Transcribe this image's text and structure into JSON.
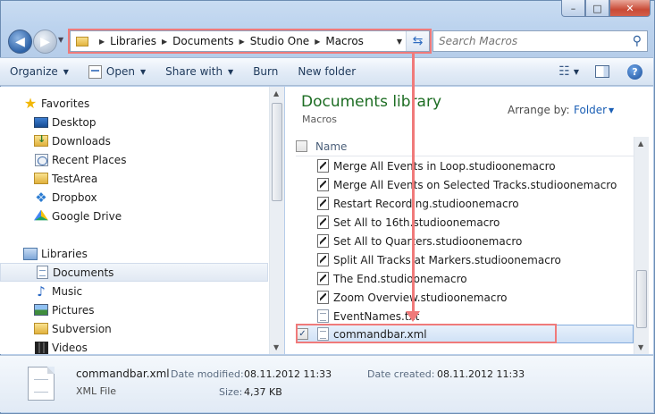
{
  "window": {
    "minimize_glyph": "–",
    "maximize_glyph": "□",
    "close_glyph": "✕"
  },
  "navigation": {
    "back_glyph": "◀",
    "forward_glyph": "▶",
    "breadcrumb": [
      "Libraries",
      "Documents",
      "Studio One",
      "Macros"
    ],
    "search_placeholder": "Search Macros"
  },
  "toolbar": {
    "organize": "Organize",
    "open": "Open",
    "share_with": "Share with",
    "burn": "Burn",
    "new_folder": "New folder",
    "help_glyph": "?"
  },
  "sidebar": {
    "favorites_label": "Favorites",
    "favorites": [
      "Desktop",
      "Downloads",
      "Recent Places",
      "TestArea",
      "Dropbox",
      "Google Drive"
    ],
    "libraries_label": "Libraries",
    "libraries": [
      "Documents",
      "Music",
      "Pictures",
      "Subversion",
      "Videos"
    ],
    "selected": "Documents"
  },
  "content": {
    "title": "Documents library",
    "subtitle": "Macros",
    "arrange_by_label": "Arrange by:",
    "arrange_by_value": "Folder",
    "column_name": "Name",
    "files": [
      {
        "name": "Merge All Events in Loop.studioonemacro",
        "icon": "macro-file-icon"
      },
      {
        "name": "Merge All Events on Selected Tracks.studioonemacro",
        "icon": "macro-file-icon"
      },
      {
        "name": "Restart Recording.studioonemacro",
        "icon": "macro-file-icon"
      },
      {
        "name": "Set All to 16th.studioonemacro",
        "icon": "macro-file-icon"
      },
      {
        "name": "Set All to Quarters.studioonemacro",
        "icon": "macro-file-icon"
      },
      {
        "name": "Split All Tracks at Markers.studioonemacro",
        "icon": "macro-file-icon"
      },
      {
        "name": "The End.studioonemacro",
        "icon": "macro-file-icon"
      },
      {
        "name": "Zoom Overview.studioonemacro",
        "icon": "macro-file-icon"
      },
      {
        "name": "EventNames.txt",
        "icon": "text-file-icon"
      },
      {
        "name": "commandbar.xml",
        "icon": "text-file-icon",
        "selected": true
      }
    ]
  },
  "details": {
    "file_name": "commandbar.xml",
    "file_type": "XML File",
    "date_modified_label": "Date modified:",
    "date_modified": "08.11.2012 11:33",
    "date_created_label": "Date created:",
    "date_created": "08.11.2012 11:33",
    "size_label": "Size:",
    "size": "4,37 KB"
  },
  "colors": {
    "annotation": "#f07a7a",
    "library_title": "#1d6d23",
    "link": "#1b5fb5",
    "selection": "#cfe1f6"
  }
}
